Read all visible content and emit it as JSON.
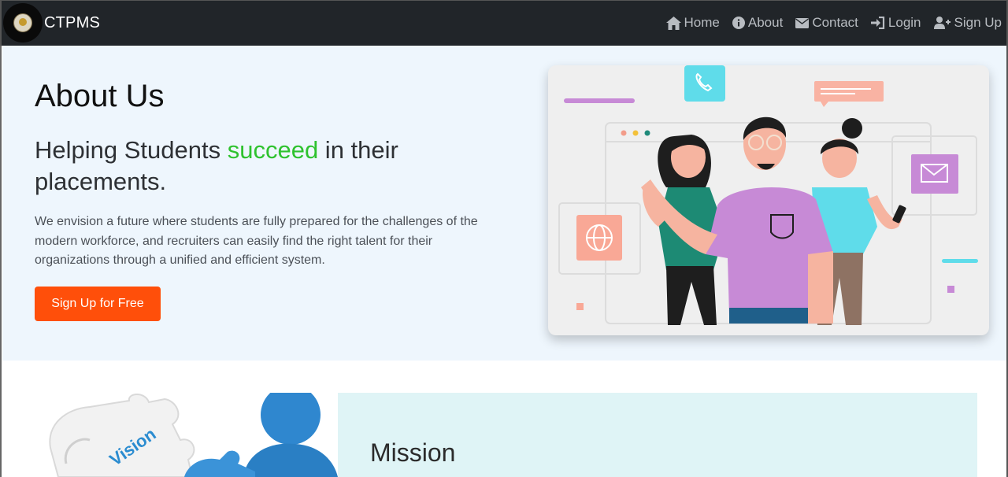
{
  "navbar": {
    "brand": "CTPMS",
    "links": [
      {
        "label": "Home",
        "icon": "home-icon"
      },
      {
        "label": "About",
        "icon": "info-icon"
      },
      {
        "label": "Contact",
        "icon": "envelope-icon"
      },
      {
        "label": "Login",
        "icon": "login-icon"
      },
      {
        "label": "Sign Up",
        "icon": "user-plus-icon"
      }
    ]
  },
  "hero": {
    "title": "About Us",
    "subtitle_before": "Helping Students ",
    "subtitle_accent": "succeed",
    "subtitle_after": " in their placements.",
    "description": "We envision a future where students are fully prepared for the challenges of the modern workforce, and recruiters can easily find the right talent for their organizations through a unified and efficient system.",
    "cta_label": "Sign Up for Free"
  },
  "mission": {
    "title": "Mission",
    "image_label": "Vision"
  },
  "colors": {
    "navbar_bg": "#212529",
    "hero_bg": "#eef6fd",
    "accent_green": "#2ec22e",
    "cta_orange": "#ff4f0a",
    "mission_bg": "#dff4f6"
  }
}
